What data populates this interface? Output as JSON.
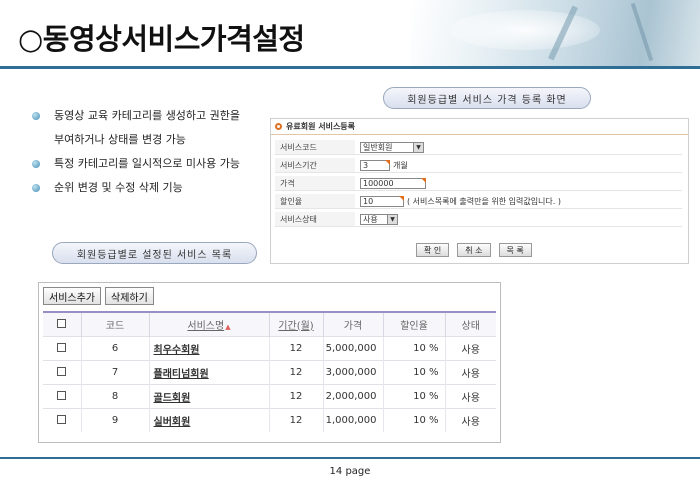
{
  "title": "○동영상서비스가격설정",
  "bullets": [
    "동영상 교육 카테고리를 생성하고 권한을\n부여하거나 상태를 변경 가능",
    "특정 카테고리를 일시적으로 미사용 가능",
    "순위 변경 및 수정 삭제 기능"
  ],
  "register_caption": "회원등급별 서비스 가격 등록 화면",
  "list_caption": "회원등급별로 설정된 서비스 목록",
  "register_form": {
    "heading": "유료회원 서비스등록",
    "fields": {
      "code_label": "서비스코드",
      "code_value": "일반회원",
      "period_label": "서비스기간",
      "period_value": "3",
      "period_unit": "개월",
      "price_label": "가격",
      "price_value": "100000",
      "discount_label": "할인율",
      "discount_value": "10",
      "discount_note": "( 서비스목록에 출력만을 위한 입력값입니다. )",
      "status_label": "서비스상태",
      "status_value": "사용"
    },
    "buttons": {
      "confirm": "확 인",
      "cancel": "취 소",
      "list": "목 록"
    }
  },
  "service_list": {
    "toolbar": {
      "add": "서비스추가",
      "delete": "삭제하기"
    },
    "columns": {
      "code": "코드",
      "name": "서비스명",
      "period": "기간(월)",
      "price": "가격",
      "discount": "할인율",
      "status": "상태"
    },
    "rows": [
      {
        "code": "6",
        "name": "최우수회원",
        "period": "12",
        "price": "5,000,000",
        "discount": "10 %",
        "status": "사용"
      },
      {
        "code": "7",
        "name": "플래티넘회원",
        "period": "12",
        "price": "3,000,000",
        "discount": "10 %",
        "status": "사용"
      },
      {
        "code": "8",
        "name": "골드회원",
        "period": "12",
        "price": "2,000,000",
        "discount": "10 %",
        "status": "사용"
      },
      {
        "code": "9",
        "name": "실버회원",
        "period": "12",
        "price": "1,000,000",
        "discount": "10 %",
        "status": "사용"
      }
    ]
  },
  "page_number": "14 page",
  "colors": {
    "accent_line": "#2f6f96",
    "table_header_border": "#9a8fc4",
    "required_marker": "#e07020"
  }
}
